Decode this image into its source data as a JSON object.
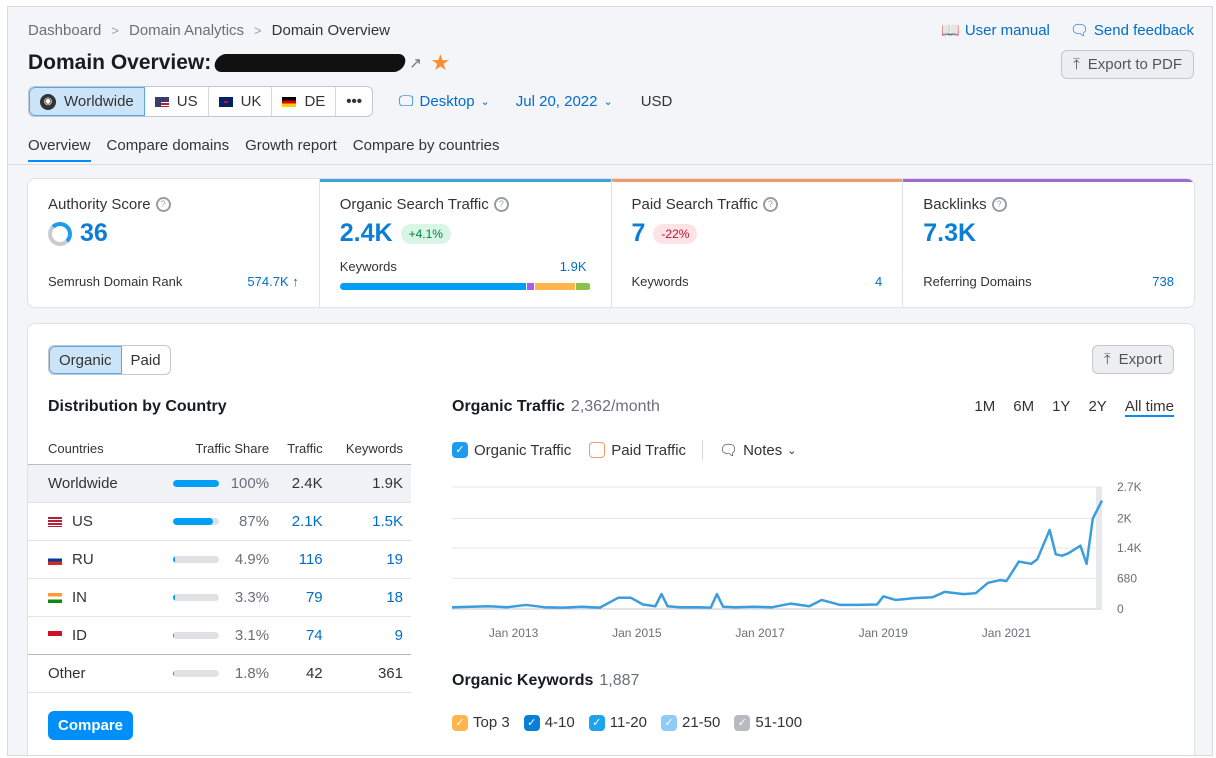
{
  "breadcrumb": [
    "Dashboard",
    "Domain Analytics",
    "Domain Overview"
  ],
  "top_links": {
    "user_manual": "User manual",
    "send_feedback": "Send feedback"
  },
  "title": "Domain Overview:",
  "export_pdf": "Export to PDF",
  "filters": {
    "regions": [
      {
        "label": "Worldwide",
        "icon": "globe-icon",
        "active": true
      },
      {
        "label": "US",
        "icon": "us-flag-icon"
      },
      {
        "label": "UK",
        "icon": "uk-flag-icon"
      },
      {
        "label": "DE",
        "icon": "de-flag-icon"
      },
      {
        "label": "•••",
        "icon": "more-icon"
      }
    ],
    "device": "Desktop",
    "date": "Jul 20, 2022",
    "currency": "USD"
  },
  "tabs": [
    "Overview",
    "Compare domains",
    "Growth report",
    "Compare by countries"
  ],
  "cards": {
    "authority": {
      "label": "Authority Score",
      "value": "36",
      "foot_label": "Semrush Domain Rank",
      "foot_value": "574.7K ↑"
    },
    "organic": {
      "label": "Organic Search Traffic",
      "value": "2.4K",
      "badge": "+4.1%",
      "kw_label": "Keywords",
      "kw_value": "1.9K",
      "kw_bar": [
        {
          "share": 0.75,
          "color": "#009ff4"
        },
        {
          "share": 0.03,
          "color": "#a75ee3"
        },
        {
          "share": 0.16,
          "color": "#ffb54c"
        },
        {
          "share": 0.06,
          "color": "#8bc34a"
        }
      ]
    },
    "paid": {
      "label": "Paid Search Traffic",
      "value": "7",
      "badge": "-22%",
      "foot_label": "Keywords",
      "foot_value": "4"
    },
    "backlinks": {
      "label": "Backlinks",
      "value": "7.3K",
      "foot_label": "Referring Domains",
      "foot_value": "738"
    }
  },
  "colors": {
    "organic_top": "#3aa3e3",
    "paid_top": "#f29a6b",
    "backlinks_top": "#9c6ad6"
  },
  "toggle": {
    "organic": "Organic",
    "paid": "Paid"
  },
  "export": "Export",
  "distribution": {
    "title": "Distribution by Country",
    "headers": [
      "Countries",
      "Traffic Share",
      "Traffic",
      "Keywords"
    ],
    "rows": [
      {
        "country": "Worldwide",
        "share": 100,
        "share_label": "100%",
        "traffic": "2.4K",
        "keywords": "1.9K"
      },
      {
        "country": "US",
        "flag": "us",
        "share": 87,
        "share_label": "87%",
        "traffic": "2.1K",
        "keywords": "1.5K"
      },
      {
        "country": "RU",
        "flag": "ru",
        "share": 4.9,
        "share_label": "4.9%",
        "traffic": "116",
        "keywords": "19"
      },
      {
        "country": "IN",
        "flag": "in",
        "share": 3.3,
        "share_label": "3.3%",
        "traffic": "79",
        "keywords": "18"
      },
      {
        "country": "ID",
        "flag": "id",
        "share": 3.1,
        "share_label": "3.1%",
        "traffic": "74",
        "keywords": "9"
      },
      {
        "country": "Other",
        "share": 1.8,
        "share_label": "1.8%",
        "traffic": "42",
        "keywords": "361"
      }
    ],
    "compare": "Compare"
  },
  "organic_traffic": {
    "title": "Organic Traffic",
    "value": "2,362/month",
    "ranges": [
      "1M",
      "6M",
      "1Y",
      "2Y",
      "All time"
    ],
    "active_range": "All time",
    "legend": {
      "organic": "Organic Traffic",
      "paid": "Paid Traffic",
      "notes": "Notes"
    }
  },
  "chart_data": {
    "type": "line",
    "title": "Organic Traffic",
    "x_ticks": [
      "Jan 2013",
      "Jan 2015",
      "Jan 2017",
      "Jan 2019",
      "Jan 2021"
    ],
    "y_ticks": [
      "0",
      "680",
      "1.4K",
      "2K",
      "2.7K"
    ],
    "ylim": [
      0,
      2700
    ],
    "xlim": [
      2012.0,
      2022.55
    ],
    "grid": true,
    "series": [
      {
        "name": "Organic Traffic",
        "color": "#3b9ddd",
        "x": [
          2012.0,
          2012.3,
          2012.6,
          2012.9,
          2013.2,
          2013.5,
          2013.8,
          2014.1,
          2014.4,
          2014.7,
          2014.9,
          2015.1,
          2015.3,
          2015.4,
          2015.5,
          2015.7,
          2016.0,
          2016.2,
          2016.3,
          2016.4,
          2016.6,
          2016.9,
          2017.2,
          2017.5,
          2017.8,
          2018.0,
          2018.3,
          2018.6,
          2018.9,
          2019.0,
          2019.2,
          2019.5,
          2019.8,
          2020.0,
          2020.3,
          2020.5,
          2020.7,
          2020.9,
          2021.0,
          2021.2,
          2021.4,
          2021.5,
          2021.7,
          2021.8,
          2021.9,
          2022.0,
          2022.2,
          2022.3,
          2022.4,
          2022.55
        ],
        "y": [
          40,
          50,
          60,
          40,
          90,
          40,
          30,
          50,
          30,
          250,
          250,
          100,
          60,
          330,
          60,
          40,
          40,
          30,
          330,
          50,
          40,
          50,
          40,
          120,
          60,
          200,
          90,
          90,
          100,
          280,
          200,
          240,
          260,
          380,
          330,
          350,
          580,
          640,
          620,
          1050,
          1000,
          1100,
          1750,
          1210,
          1180,
          1230,
          1400,
          1000,
          2000,
          2400
        ]
      }
    ]
  },
  "organic_keywords": {
    "title": "Organic Keywords",
    "value": "1,887",
    "legend": [
      {
        "label": "Top 3",
        "color": "#ffb54c"
      },
      {
        "label": "4-10",
        "color": "#0b7fd6"
      },
      {
        "label": "11-20",
        "color": "#1ea4ee"
      },
      {
        "label": "21-50",
        "color": "#8ecbf5"
      },
      {
        "label": "51-100",
        "color": "#b8bac2"
      }
    ]
  }
}
